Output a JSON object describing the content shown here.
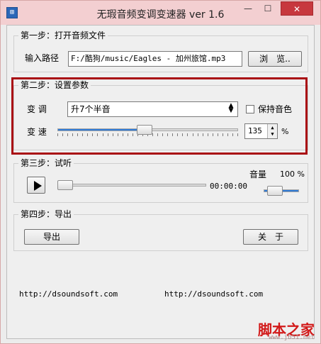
{
  "window": {
    "title": "无瑕音频变调变速器 ver 1.6",
    "icon_glyph": "⊞",
    "minimize_glyph": "—",
    "maximize_glyph": "☐",
    "close_glyph": "✕"
  },
  "step1": {
    "legend": "第一步：打开音频文件",
    "path_label": "输入路径",
    "path_value": "F:/酷狗/music/Eagles - 加州旅馆.mp3",
    "browse_label": "浏　览.."
  },
  "step2": {
    "legend": "第二步：设置参数",
    "pitch_label": "变 调",
    "pitch_value": "升7个半音",
    "keep_timbre_label": "保持音色",
    "keep_timbre_checked": false,
    "speed_label": "变 速",
    "speed_value": "135",
    "speed_unit": "%",
    "speed_slider_fraction": 0.48
  },
  "step3": {
    "legend": "第三步：试听",
    "time": "00:00:00",
    "volume_label": "音量",
    "volume_value": "100 %",
    "progress_fraction": 0.0
  },
  "step4": {
    "legend": "第四步：导出",
    "export_label": "导出",
    "about_label": "关　于"
  },
  "footer": {
    "url_left": "http://dsoundsoft.com",
    "url_right": "http://dsoundsoft.com"
  },
  "watermark": {
    "text": "脚本之家",
    "sub": "www.jb51.net"
  },
  "colors": {
    "accent": "#2e7ad6",
    "highlight": "#a90d14",
    "close": "#c7383e",
    "titlebar": "#f3cfd1"
  }
}
